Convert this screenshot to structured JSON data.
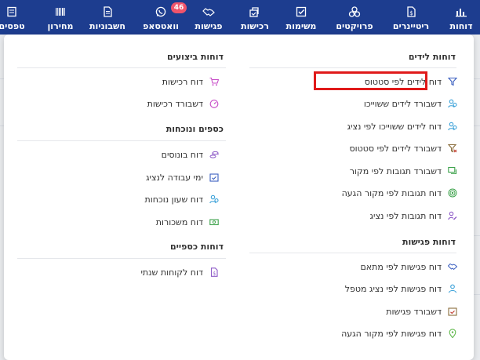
{
  "topnav": {
    "items": [
      {
        "key": "reports",
        "label": "דוחות",
        "icon": "bar-chart-icon"
      },
      {
        "key": "retainers",
        "label": "ריטיינרים",
        "icon": "dollar-doc-icon"
      },
      {
        "key": "projects",
        "label": "פרויקטים",
        "icon": "cubes-icon"
      },
      {
        "key": "tasks",
        "label": "משימות",
        "icon": "checkbox-icon"
      },
      {
        "key": "purchases",
        "label": "רכישות",
        "icon": "purchase-icon"
      },
      {
        "key": "meetings",
        "label": "פגישות",
        "icon": "handshake-icon"
      },
      {
        "key": "whatsapp",
        "label": "וואטסאפ",
        "icon": "whatsapp-icon"
      },
      {
        "key": "invoices",
        "label": "חשבוניות",
        "icon": "document-icon"
      },
      {
        "key": "pricelist",
        "label": "מחירון",
        "icon": "barcode-icon"
      },
      {
        "key": "forms",
        "label": "טפסים",
        "icon": "forms-icon"
      }
    ],
    "whatsapp_badge": "46"
  },
  "menu": {
    "right_column": {
      "leads_title": "דוחות לידים",
      "leads_items": [
        {
          "label": "דוח לידים לפי סטטוס",
          "icon": "filter-icon",
          "color": "#3b5fc0"
        },
        {
          "label": "דשבורד לידים ששוייכו",
          "icon": "users-icon",
          "color": "#39a0d8"
        },
        {
          "label": "דוח לידים ששוייכו לפי נציג",
          "icon": "users-icon",
          "color": "#39a0d8"
        },
        {
          "label": "דשבורד לידים לפי סטטוס",
          "icon": "filter-x-icon",
          "color": "#8a6d3b"
        },
        {
          "label": "דשבורד תגובות לפי מקור",
          "icon": "chat-icon",
          "color": "#3fa34d"
        },
        {
          "label": "דוח תגובות לפי מקור הגעה",
          "icon": "target-icon",
          "color": "#3fa34d"
        },
        {
          "label": "דוח תגובות לפי נציג",
          "icon": "user-edit-icon",
          "color": "#8e5bc7"
        }
      ],
      "meetings_title": "דוחות פגישות",
      "meetings_items": [
        {
          "label": "דוח פגישות לפי מתאם",
          "icon": "handshake-icon",
          "color": "#3b5fc0"
        },
        {
          "label": "דוח פגישות לפי נציג מטפל",
          "icon": "user-icon",
          "color": "#39a0d8"
        },
        {
          "label": "דשבורד פגישות",
          "icon": "calendar-check-icon",
          "color": "#8a6d3b"
        },
        {
          "label": "דוח פגישות לפי מקור הגעה",
          "icon": "location-icon",
          "color": "#5fb84a"
        }
      ]
    },
    "left_column": {
      "performance_title": "דוחות ביצועים",
      "performance_items": [
        {
          "label": "דוח רכישות",
          "icon": "cart-icon",
          "color": "#c84fc8"
        },
        {
          "label": "דשבורד רכישות",
          "icon": "gauge-icon",
          "color": "#c84fc8"
        }
      ],
      "money_title": "כספים ונוכחות",
      "money_items": [
        {
          "label": "דוח בונוסים",
          "icon": "coins-icon",
          "color": "#8e5bc7"
        },
        {
          "label": "ימי עבודה לנציג",
          "icon": "calendar-check-icon",
          "color": "#3b5fc0"
        },
        {
          "label": "דוח שעון נוכחות",
          "icon": "users-icon",
          "color": "#39a0d8"
        },
        {
          "label": "דוח משכורות",
          "icon": "money-icon",
          "color": "#3fa34d"
        }
      ],
      "finance_title": "דוחות כספיים",
      "finance_items": [
        {
          "label": "דוח לקוחות שנתי",
          "icon": "dollar-doc-icon",
          "color": "#8e5bc7"
        }
      ]
    }
  }
}
